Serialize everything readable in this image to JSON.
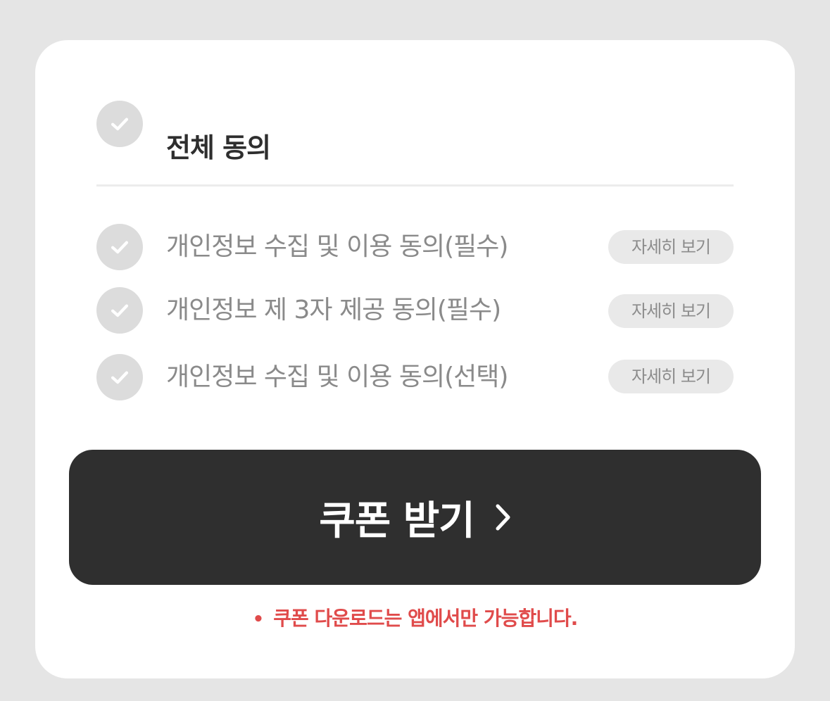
{
  "agreement": {
    "all_label": "전체 동의",
    "items": [
      {
        "label": "개인정보 수집 및 이용 동의(필수)",
        "detail_label": "자세히 보기",
        "checked": false
      },
      {
        "label": "개인정보 제 3자 제공 동의(필수)",
        "detail_label": "자세히 보기",
        "checked": false
      },
      {
        "label": "개인정보 수집 및 이용 동의(선택)",
        "detail_label": "자세히 보기",
        "checked": false
      }
    ]
  },
  "cta": {
    "label": "쿠폰 받기",
    "icon": "chevron-right-icon"
  },
  "notice": {
    "bullet": "•",
    "text": "쿠폰 다운로드는 앱에서만 가능합니다."
  },
  "colors": {
    "background": "#e5e5e5",
    "card": "#ffffff",
    "check_inactive": "#dcdcdc",
    "cta_background": "#2f2f2f",
    "notice_text": "#e04b4b"
  }
}
